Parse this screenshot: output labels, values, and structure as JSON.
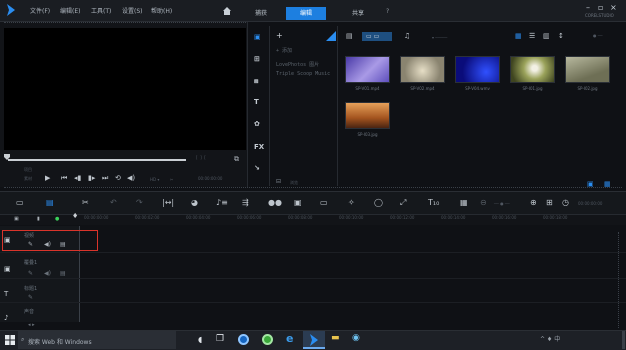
{
  "app": {
    "menu": [
      "文件(F)",
      "编辑(E)",
      "工具(T)",
      "设置(S)",
      "帮助(H)"
    ],
    "tabs": [
      "捕获",
      "编辑",
      "共享"
    ],
    "active_tab": "编辑",
    "window_title_text": "CORELSTUDIO"
  },
  "library": {
    "list_items": [
      "+ 添加",
      "LovePhotos 图片",
      "Triple Scoop Music"
    ],
    "thumbnails": [
      {
        "label": "SP-V01.mp4",
        "color": "#6a55c2"
      },
      {
        "label": "SP-V02.mp4",
        "color": "#b8b09a"
      },
      {
        "label": "SP-V04.wmv",
        "color": "#1418a0"
      },
      {
        "label": "SP-I01.jpg",
        "color": "#77803a"
      },
      {
        "label": "SP-I02.jpg",
        "color": "#8a8b70"
      },
      {
        "label": "SP-I03.jpg",
        "color": "#c7712d"
      }
    ],
    "browse_label": "浏览"
  },
  "preview": {
    "mode_labels": [
      "项目",
      "素材"
    ],
    "timecode": "00:00:00:00"
  },
  "timeline": {
    "ruler_ticks": [
      "00:00:00:00",
      "00:00:02:00",
      "00:00:04:00",
      "00:00:06:00",
      "00:00:08:00",
      "00:00:10:00",
      "00:00:12:00",
      "00:00:14:00",
      "00:00:16:00",
      "00:00:18:00"
    ],
    "tracks": [
      {
        "name": "视频",
        "icon": "video-track-icon"
      },
      {
        "name": "覆叠1",
        "icon": "overlay-track-icon"
      },
      {
        "name": "标题1",
        "icon": "title-track-icon"
      },
      {
        "name": "声音",
        "icon": "voice-track-icon"
      }
    ]
  },
  "taskbar": {
    "search_text": "搜索 Web 和 Windows",
    "tray_text": "^  ♦  中"
  }
}
